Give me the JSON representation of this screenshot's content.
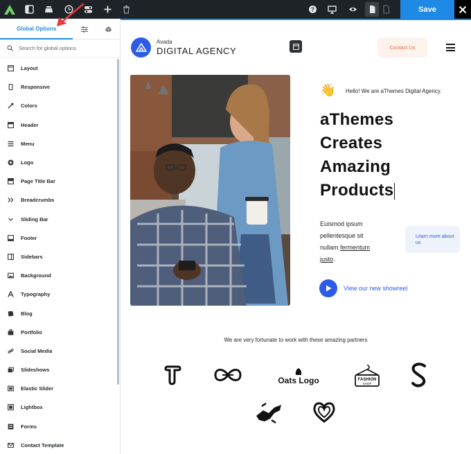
{
  "toolbar": {
    "save_label": "Save",
    "icons": [
      "avada-logo-icon",
      "sidebar-toggle-icon",
      "library-icon",
      "history-icon",
      "options-toggle-icon",
      "add-icon",
      "trash-icon",
      "help-icon",
      "desktop-icon",
      "preview-eye-icon",
      "page-icon",
      "blank-page-icon",
      "close-icon"
    ]
  },
  "sidebar": {
    "tab_global_options": "Global Options",
    "search_placeholder": "Search for global options",
    "items": [
      {
        "label": "Layout",
        "icon": "layout-icon"
      },
      {
        "label": "Responsive",
        "icon": "mobile-icon"
      },
      {
        "label": "Colors",
        "icon": "eyedropper-icon"
      },
      {
        "label": "Header",
        "icon": "header-icon"
      },
      {
        "label": "Menu",
        "icon": "menu-icon"
      },
      {
        "label": "Logo",
        "icon": "logo-icon"
      },
      {
        "label": "Page Title Bar",
        "icon": "title-bar-icon"
      },
      {
        "label": "Breadcrumbs",
        "icon": "breadcrumbs-icon"
      },
      {
        "label": "Sliding Bar",
        "icon": "chevron-down-icon"
      },
      {
        "label": "Footer",
        "icon": "footer-icon"
      },
      {
        "label": "Sidebars",
        "icon": "sidebars-icon"
      },
      {
        "label": "Background",
        "icon": "image-icon"
      },
      {
        "label": "Typography",
        "icon": "typography-icon"
      },
      {
        "label": "Blog",
        "icon": "blog-icon"
      },
      {
        "label": "Portfolio",
        "icon": "portfolio-icon"
      },
      {
        "label": "Social Media",
        "icon": "link-icon"
      },
      {
        "label": "Slideshows",
        "icon": "slideshow-icon"
      },
      {
        "label": "Elastic Slider",
        "icon": "slider-icon"
      },
      {
        "label": "Lightbox",
        "icon": "lightbox-icon"
      },
      {
        "label": "Forms",
        "icon": "forms-icon"
      },
      {
        "label": "Contact Template",
        "icon": "envelope-icon"
      }
    ]
  },
  "preview": {
    "brand_small": "Avada",
    "brand_big": "DIGITAL AGENCY",
    "contact_label": "Contact Us",
    "hello_text": "Hello! We are aThemes Digital Agency.",
    "headline": [
      "aThemes",
      "Creates",
      "Amazing",
      "Products"
    ],
    "body_line1": "Euismod ipsum",
    "body_line2": "pellentesque sit",
    "body_line3_a": "nullam ",
    "body_line3_b": "fermentum",
    "body_line4": "justo",
    "body_line4_end": ".",
    "learn_more": "Learn more about us",
    "showreel_label": "View our new showreel",
    "partners_text": "We are very fortunate to work with these amazing partners",
    "oats_logo": "Oats Logo",
    "fashion_logo_line1": "FASHION",
    "fashion_logo_line2": "SHOP"
  },
  "colors": {
    "toolbar_bg": "#1d2327",
    "accent_blue": "#1e8ae6",
    "brand_blue": "#2c5ce6",
    "contact_text": "#e56b3c",
    "annotation_red": "#e8373d"
  }
}
